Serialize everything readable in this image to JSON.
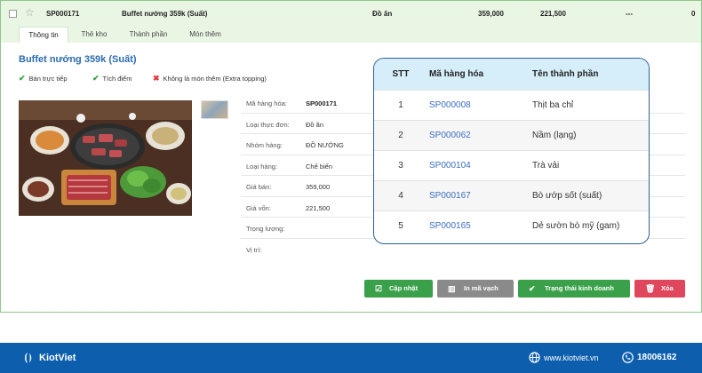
{
  "row": {
    "code": "SP000171",
    "name": "Buffet nướng 359k (Suất)",
    "type": "Đồ ăn",
    "price": "359,000",
    "cost": "221,500",
    "dash": "---",
    "stock": "0"
  },
  "tabs": [
    "Thông tin",
    "Thẻ kho",
    "Thành phần",
    "Món thêm"
  ],
  "product": {
    "title": "Buffet nướng 359k (Suất)",
    "flags": [
      {
        "label": "Bán trực tiếp",
        "state": "checked"
      },
      {
        "label": "Tích điểm",
        "state": "checked"
      },
      {
        "label": "Không là món thêm (Extra topping)",
        "state": "crossed"
      }
    ]
  },
  "info": [
    {
      "label": "Mã hàng hóa:",
      "value": "SP000171"
    },
    {
      "label": "Loại thực đơn:",
      "value": "Đồ ăn"
    },
    {
      "label": "Nhóm hàng:",
      "value": "ĐỒ NƯỚNG"
    },
    {
      "label": "Loại hàng:",
      "value": "Chế biến"
    },
    {
      "label": "Giá bán:",
      "value": "359,000"
    },
    {
      "label": "Giá vốn:",
      "value": "221,500"
    },
    {
      "label": "Trọng lượng:",
      "value": ""
    },
    {
      "label": "Vị trí:",
      "value": ""
    }
  ],
  "ingredients": {
    "headers": {
      "stt": "STT",
      "code": "Mã hàng hóa",
      "name": "Tên thành phần"
    },
    "rows": [
      {
        "stt": "1",
        "code": "SP000008",
        "name": "Thịt ba chỉ"
      },
      {
        "stt": "2",
        "code": "SP000062",
        "name": "Nầm (lạng)"
      },
      {
        "stt": "3",
        "code": "SP000104",
        "name": "Trà vải"
      },
      {
        "stt": "4",
        "code": "SP000167",
        "name": "Bò ướp sốt (suất)"
      },
      {
        "stt": "5",
        "code": "SP000165",
        "name": "Dẻ sườn bò mỹ (gam)"
      }
    ]
  },
  "actions": {
    "update": "Cập nhật",
    "barcode": "In mã vạch",
    "status": "Trạng thái kinh doanh",
    "delete": "Xóa"
  },
  "footer": {
    "brand": "KiotViet",
    "website": "www.kiotviet.vn",
    "phone": "18006162"
  },
  "colors": {
    "accent_green": "#3aa04a",
    "brand_blue": "#0d5fae",
    "danger": "#e0475c",
    "link": "#3b6ec1"
  }
}
